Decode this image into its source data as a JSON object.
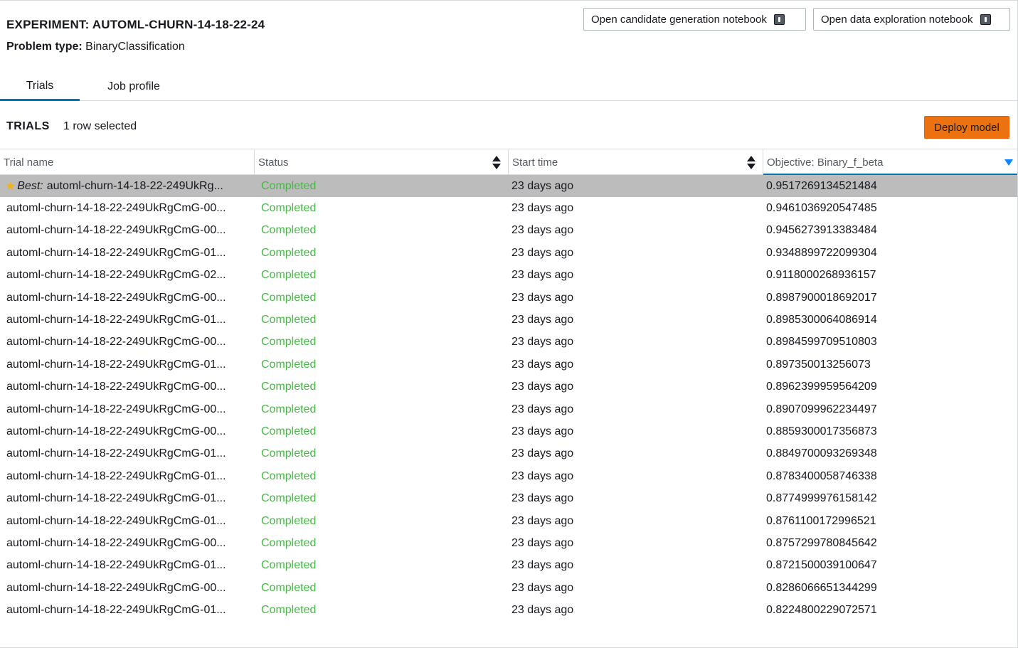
{
  "experiment": {
    "title": "EXPERIMENT: AUTOML-CHURN-14-18-22-24",
    "problem_label": "Problem type:",
    "problem_value": "BinaryClassification"
  },
  "header_buttons": {
    "candidate": "Open candidate generation notebook",
    "exploration": "Open data exploration notebook"
  },
  "tabs": [
    {
      "label": "Trials",
      "active": true
    },
    {
      "label": "Job profile",
      "active": false
    }
  ],
  "trials": {
    "title": "TRIALS",
    "selection": "1 row selected",
    "deploy_label": "Deploy model",
    "columns": [
      "Trial name",
      "Status",
      "Start time",
      "Objective: Binary_f_beta"
    ],
    "best_label": "Best:",
    "rows": [
      {
        "name": "automl-churn-14-18-22-249UkRg...",
        "status": "Completed",
        "start": "23 days ago",
        "objective": "0.9517269134521484",
        "best": true
      },
      {
        "name": "automl-churn-14-18-22-249UkRgCmG-00...",
        "status": "Completed",
        "start": "23 days ago",
        "objective": "0.9461036920547485"
      },
      {
        "name": "automl-churn-14-18-22-249UkRgCmG-00...",
        "status": "Completed",
        "start": "23 days ago",
        "objective": "0.9456273913383484"
      },
      {
        "name": "automl-churn-14-18-22-249UkRgCmG-01...",
        "status": "Completed",
        "start": "23 days ago",
        "objective": "0.9348899722099304"
      },
      {
        "name": "automl-churn-14-18-22-249UkRgCmG-02...",
        "status": "Completed",
        "start": "23 days ago",
        "objective": "0.9118000268936157"
      },
      {
        "name": "automl-churn-14-18-22-249UkRgCmG-00...",
        "status": "Completed",
        "start": "23 days ago",
        "objective": "0.8987900018692017"
      },
      {
        "name": "automl-churn-14-18-22-249UkRgCmG-01...",
        "status": "Completed",
        "start": "23 days ago",
        "objective": "0.8985300064086914"
      },
      {
        "name": "automl-churn-14-18-22-249UkRgCmG-00...",
        "status": "Completed",
        "start": "23 days ago",
        "objective": "0.8984599709510803"
      },
      {
        "name": "automl-churn-14-18-22-249UkRgCmG-01...",
        "status": "Completed",
        "start": "23 days ago",
        "objective": "0.897350013256073"
      },
      {
        "name": "automl-churn-14-18-22-249UkRgCmG-00...",
        "status": "Completed",
        "start": "23 days ago",
        "objective": "0.8962399959564209"
      },
      {
        "name": "automl-churn-14-18-22-249UkRgCmG-00...",
        "status": "Completed",
        "start": "23 days ago",
        "objective": "0.8907099962234497"
      },
      {
        "name": "automl-churn-14-18-22-249UkRgCmG-00...",
        "status": "Completed",
        "start": "23 days ago",
        "objective": "0.8859300017356873"
      },
      {
        "name": "automl-churn-14-18-22-249UkRgCmG-01...",
        "status": "Completed",
        "start": "23 days ago",
        "objective": "0.8849700093269348"
      },
      {
        "name": "automl-churn-14-18-22-249UkRgCmG-01...",
        "status": "Completed",
        "start": "23 days ago",
        "objective": "0.8783400058746338"
      },
      {
        "name": "automl-churn-14-18-22-249UkRgCmG-01...",
        "status": "Completed",
        "start": "23 days ago",
        "objective": "0.8774999976158142"
      },
      {
        "name": "automl-churn-14-18-22-249UkRgCmG-01...",
        "status": "Completed",
        "start": "23 days ago",
        "objective": "0.8761100172996521"
      },
      {
        "name": "automl-churn-14-18-22-249UkRgCmG-00...",
        "status": "Completed",
        "start": "23 days ago",
        "objective": "0.8757299780845642"
      },
      {
        "name": "automl-churn-14-18-22-249UkRgCmG-01...",
        "status": "Completed",
        "start": "23 days ago",
        "objective": "0.8721500039100647"
      },
      {
        "name": "automl-churn-14-18-22-249UkRgCmG-00...",
        "status": "Completed",
        "start": "23 days ago",
        "objective": "0.8286066651344299"
      },
      {
        "name": "automl-churn-14-18-22-249UkRgCmG-01...",
        "status": "Completed",
        "start": "23 days ago",
        "objective": "0.8224800229072571"
      }
    ]
  },
  "colors": {
    "accent": "#0073bb",
    "deploy": "#ec7211",
    "status_completed": "#44b944",
    "selected_row": "#bcbcbc",
    "best_star": "#f2b40f"
  },
  "icons": {
    "external": "external-link-icon",
    "star": "star-icon",
    "sort": "sort-icon",
    "sort_desc": "sort-descending-icon"
  }
}
